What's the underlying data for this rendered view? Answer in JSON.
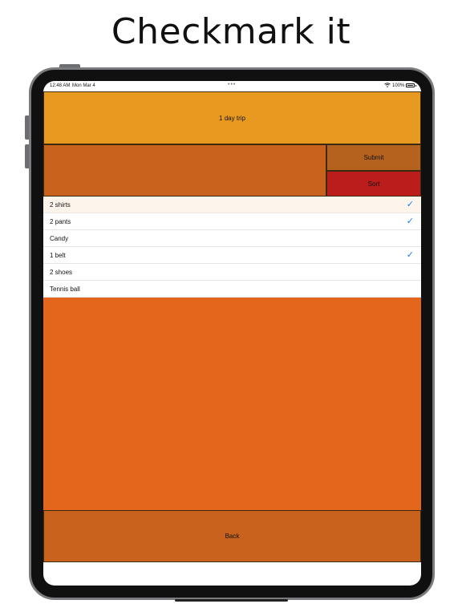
{
  "headline": "Checkmark it",
  "status_bar": {
    "time": "12:48 AM",
    "date": "Mon Mar 4",
    "dots": "•••",
    "battery": "100%",
    "wifi_icon": "wifi-icon",
    "battery_icon": "battery-icon"
  },
  "title": "1 day trip",
  "input": {
    "value": "",
    "placeholder": ""
  },
  "buttons": {
    "submit": "Submit",
    "sort": "Sort",
    "back": "Back"
  },
  "check_glyph": "✓",
  "items": [
    {
      "label": "2 shirts",
      "checked": true,
      "selected": true
    },
    {
      "label": "2 pants",
      "checked": true,
      "selected": false
    },
    {
      "label": "Candy",
      "checked": false,
      "selected": false
    },
    {
      "label": "1 belt",
      "checked": true,
      "selected": false
    },
    {
      "label": "2 shoes",
      "checked": false,
      "selected": false
    },
    {
      "label": "Tennis ball",
      "checked": false,
      "selected": false
    }
  ],
  "colors": {
    "title_bar": "#e8991f",
    "input_area": "#c9621c",
    "submit": "#b5621f",
    "sort": "#bb1c1c",
    "content_area": "#e4661c",
    "back": "#c9621c",
    "checkmark": "#1a7cf0"
  }
}
